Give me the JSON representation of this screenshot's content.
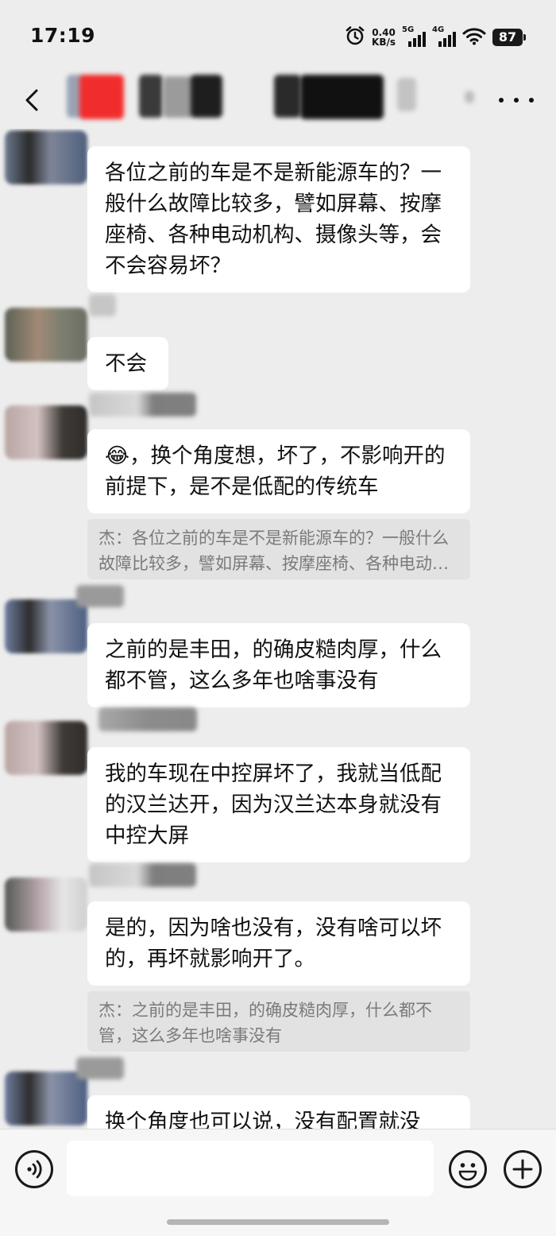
{
  "status_bar": {
    "time": "17:19",
    "net_speed_value": "0.40",
    "net_speed_unit": "KB/s",
    "signal_1_label": "5G",
    "signal_2_label": "4G",
    "battery_level": "87",
    "icons": [
      "alarm-icon",
      "wifi-icon",
      "battery-icon"
    ]
  },
  "nav": {
    "back_icon": "chevron-left-icon",
    "more_icon": "more-icon"
  },
  "messages": [
    {
      "text": "各位之前的车是不是新能源车的？一般什么故障比较多，譬如屏幕、按摩座椅、各种电动机构、摄像头等，会不会容易坏？"
    },
    {
      "text": "不会"
    },
    {
      "emoji": "😂",
      "text": "，换个角度想，坏了，不影响开的前提下，是不是低配的传统车",
      "quote": "杰：各位之前的车是不是新能源车的？一般什么故障比较多，譬如屏幕、按摩座椅、各种电动机构、摄像头等，会不会容易坏？"
    },
    {
      "text": "之前的是丰田，的确皮糙肉厚，什么都不管，这么多年也啥事没有"
    },
    {
      "text": "我的车现在中控屏坏了，我就当低配的汉兰达开，因为汉兰达本身就没有中控大屏"
    },
    {
      "text": "是的，因为啥也没有，没有啥可以坏的，再坏就影响开了。",
      "quote": "杰：之前的是丰田，的确皮糙肉厚，什么都不管，这么多年也啥事没有"
    },
    {
      "text": "换个角度也可以说，没有配置就没"
    }
  ],
  "input_bar": {
    "voice_icon": "voice-icon",
    "text_value": "",
    "emoji_icon": "emoji-icon",
    "plus_icon": "plus-icon"
  },
  "colors": {
    "background": "#ededed",
    "bubble": "#ffffff",
    "quote_bg": "#e2e2e2",
    "quote_text": "#7a7a7a"
  }
}
